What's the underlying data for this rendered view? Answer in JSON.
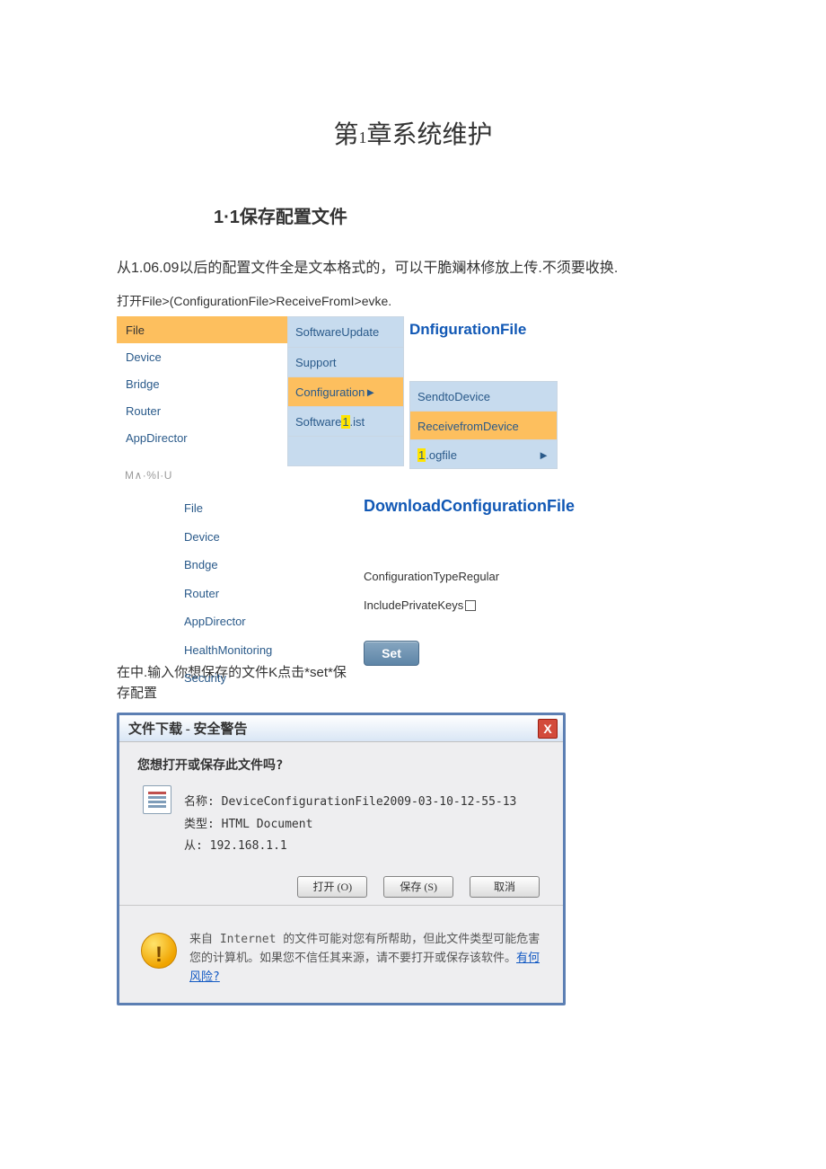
{
  "chapter_title_a": "第",
  "chapter_title_num": "1",
  "chapter_title_b": "章系统维护",
  "section_title": "1·1保存配置文件",
  "intro_para": "从1.06.09以后的配置文件全是文本格式的，可以干脆斓林修放上传.不须要收换.",
  "open_path": "打开File>(ConfigurationFile>ReceiveFromI>evke.",
  "menuA": {
    "file": "File",
    "device": "Device",
    "bridge": "Bridge",
    "router": "Router",
    "appd": "AppDirector"
  },
  "ghost": "M∧·%I·U",
  "menuB": {
    "su": "SoftwareUpdate",
    "support": "Support",
    "cfg": "Configuration►",
    "swl_a": "Software",
    "swl_b": ".ist"
  },
  "menuC_heading": "DnfigurationFile",
  "menuC": {
    "send": "SendtoDevice",
    "recv": "ReceivefromDevice",
    "log_b": ".ogfile"
  },
  "nav2": [
    "File",
    "Device",
    "Bndge",
    "Router",
    "AppDirector",
    "HealthMonitoring",
    "Security"
  ],
  "panel2": {
    "title": "DownloadConfigurationFile",
    "row1": "ConfigurationTypeRegular",
    "row2": "IncludePrivateKeys",
    "set": "Set"
  },
  "note_after": "在中.输入你想保存的文件K点击*set*保存配置",
  "dlg": {
    "title": "文件下载 - 安全警告",
    "q": "您想打开或保存此文件吗?",
    "name_lbl": "名称:",
    "name": "DeviceConfigurationFile2009-03-10-12-55-13",
    "type_lbl": "类型:",
    "type": "HTML Document",
    "from_lbl": "从:",
    "from": "192.168.1.1",
    "open": "打开 (O)",
    "save": "保存 (S)",
    "cancel": "取消",
    "warn": "来自 Internet 的文件可能对您有所帮助，但此文件类型可能危害您的计算机。如果您不信任其来源，请不要打开或保存该软件。",
    "risk": "有何风险?"
  }
}
